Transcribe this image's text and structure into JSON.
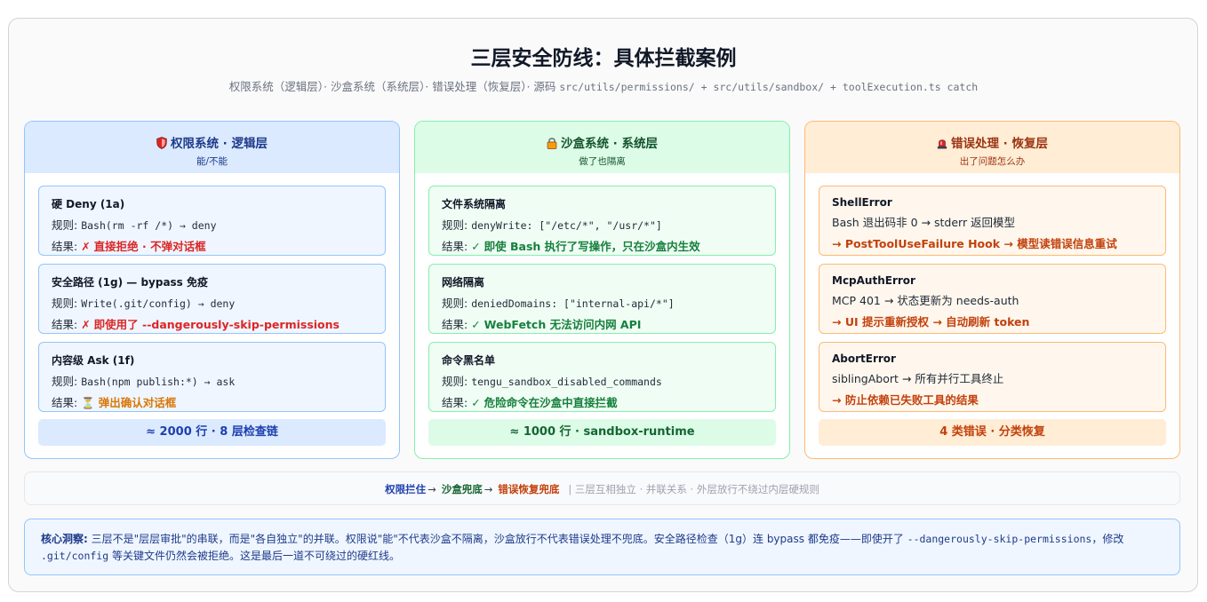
{
  "header": {
    "title": "三层安全防线：具体拦截案例",
    "subtitle_text": "权限系统（逻辑层）· 沙盒系统（系统层）· 错误处理（恢复层）· 源码",
    "subtitle_code": "src/utils/permissions/ + src/utils/sandbox/ + toolExecution.ts catch"
  },
  "columns": [
    {
      "icon": "shield-icon",
      "title": "权限系统 · 逻辑层",
      "subtitle": "能/不能",
      "cards": [
        {
          "title": "硬 Deny (1a)",
          "rule_label": "规则: ",
          "rule": "Bash(rm -rf /*) → deny",
          "result_label": "结果: ",
          "result_icon": "✗",
          "result": "直接拒绝 · 不弹对话框"
        },
        {
          "title": "安全路径 (1g) — bypass 免疫",
          "rule_label": "规则: ",
          "rule": "Write(.git/config) → deny",
          "result_label": "结果: ",
          "result_icon": "✗",
          "result": "即使用了 --dangerously-skip-permissions"
        },
        {
          "title": "内容级 Ask (1f)",
          "rule_label": "规则: ",
          "rule": "Bash(npm publish:*) → ask",
          "result_label": "结果: ",
          "result_icon": "⏳",
          "result": "弹出确认对话框"
        }
      ],
      "footer": "≈ 2000 行 · 8 层检查链"
    },
    {
      "icon": "lock-icon",
      "title": "沙盒系统 · 系统层",
      "subtitle": "做了也隔离",
      "cards": [
        {
          "title": "文件系统隔离",
          "rule_label": "规则: ",
          "rule": "denyWrite: [\"/etc/*\", \"/usr/*\"]",
          "result_label": "结果: ",
          "result_icon": "✓",
          "result": "即使 Bash 执行了写操作，只在沙盒内生效"
        },
        {
          "title": "网络隔离",
          "rule_label": "规则: ",
          "rule": "deniedDomains: [\"internal-api/*\"]",
          "result_label": "结果: ",
          "result_icon": "✓",
          "result": "WebFetch 无法访问内网 API"
        },
        {
          "title": "命令黑名单",
          "rule_label": "规则: ",
          "rule": "tengu_sandbox_disabled_commands",
          "result_label": "结果: ",
          "result_icon": "✓",
          "result": "危险命令在沙盒中直接拦截"
        }
      ],
      "footer": "≈ 1000 行 · sandbox-runtime"
    },
    {
      "icon": "alarm-light-icon",
      "title": "错误处理 · 恢复层",
      "subtitle": "出了问题怎么办",
      "cards": [
        {
          "title": "ShellError",
          "detail": "Bash 退出码非 0 → stderr 返回模型",
          "result": "→ PostToolUseFailure Hook → 模型读错误信息重试"
        },
        {
          "title": "McpAuthError",
          "detail": "MCP 401 → 状态更新为 needs-auth",
          "result": "→ UI 提示重新授权 → 自动刷新 token"
        },
        {
          "title": "AbortError",
          "detail": "siblingAbort → 所有并行工具终止",
          "result": "→ 防止依赖已失败工具的结果"
        }
      ],
      "footer": "4 类错误 · 分类恢复"
    }
  ],
  "flow": {
    "step1": "权限拦住",
    "step2": "沙盒兜底",
    "step3": "错误恢复兜底",
    "arrow": "→",
    "note": "| 三层互相独立 · 并联关系 · 外层放行不绕过内层硬规则"
  },
  "insight": {
    "label": "核心洞察:",
    "text1": " 三层不是\"层层审批\"的串联，而是\"各自独立\"的并联。权限说\"能\"不代表沙盒不隔离，沙盒放行不代表错误处理不兜底。安全路径检查（1g）连 bypass 都免疫——即使开了 ",
    "code1": "--dangerously-skip-permissions",
    "text2": "，修改 ",
    "code2": ".git/config",
    "text3": " 等关键文件仍然会被拒绝。这是最后一道不可绕过的硬红线。"
  }
}
